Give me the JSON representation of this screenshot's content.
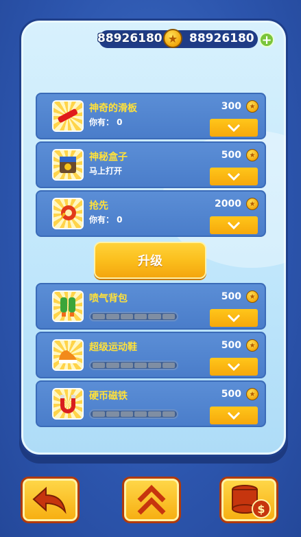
{
  "header": {
    "score": "88926180",
    "coins": "88926180"
  },
  "items": [
    {
      "title": "神奇的滑板",
      "sub": "你有：  0",
      "price": "300",
      "icon": "skateboard-icon"
    },
    {
      "title": "神秘盒子",
      "sub": "马上打开",
      "price": "500",
      "icon": "mystery-box-icon"
    },
    {
      "title": "抢先",
      "sub": "你有：  0",
      "price": "2000",
      "icon": "headstart-icon"
    }
  ],
  "upgrade_label": "升级",
  "powerups": [
    {
      "title": "喷气背包",
      "price": "500",
      "icon": "jetpack-icon",
      "level": 0,
      "max_level": 6
    },
    {
      "title": "超级运动鞋",
      "price": "500",
      "icon": "super-sneakers-icon",
      "level": 0,
      "max_level": 6
    },
    {
      "title": "硬币磁铁",
      "price": "500",
      "icon": "coin-magnet-icon",
      "level": 0,
      "max_level": 6
    }
  ],
  "colors": {
    "accent": "#f6a80b",
    "title": "#ffe13a",
    "row": "#4f84cf",
    "panel": "#c6eafc"
  }
}
